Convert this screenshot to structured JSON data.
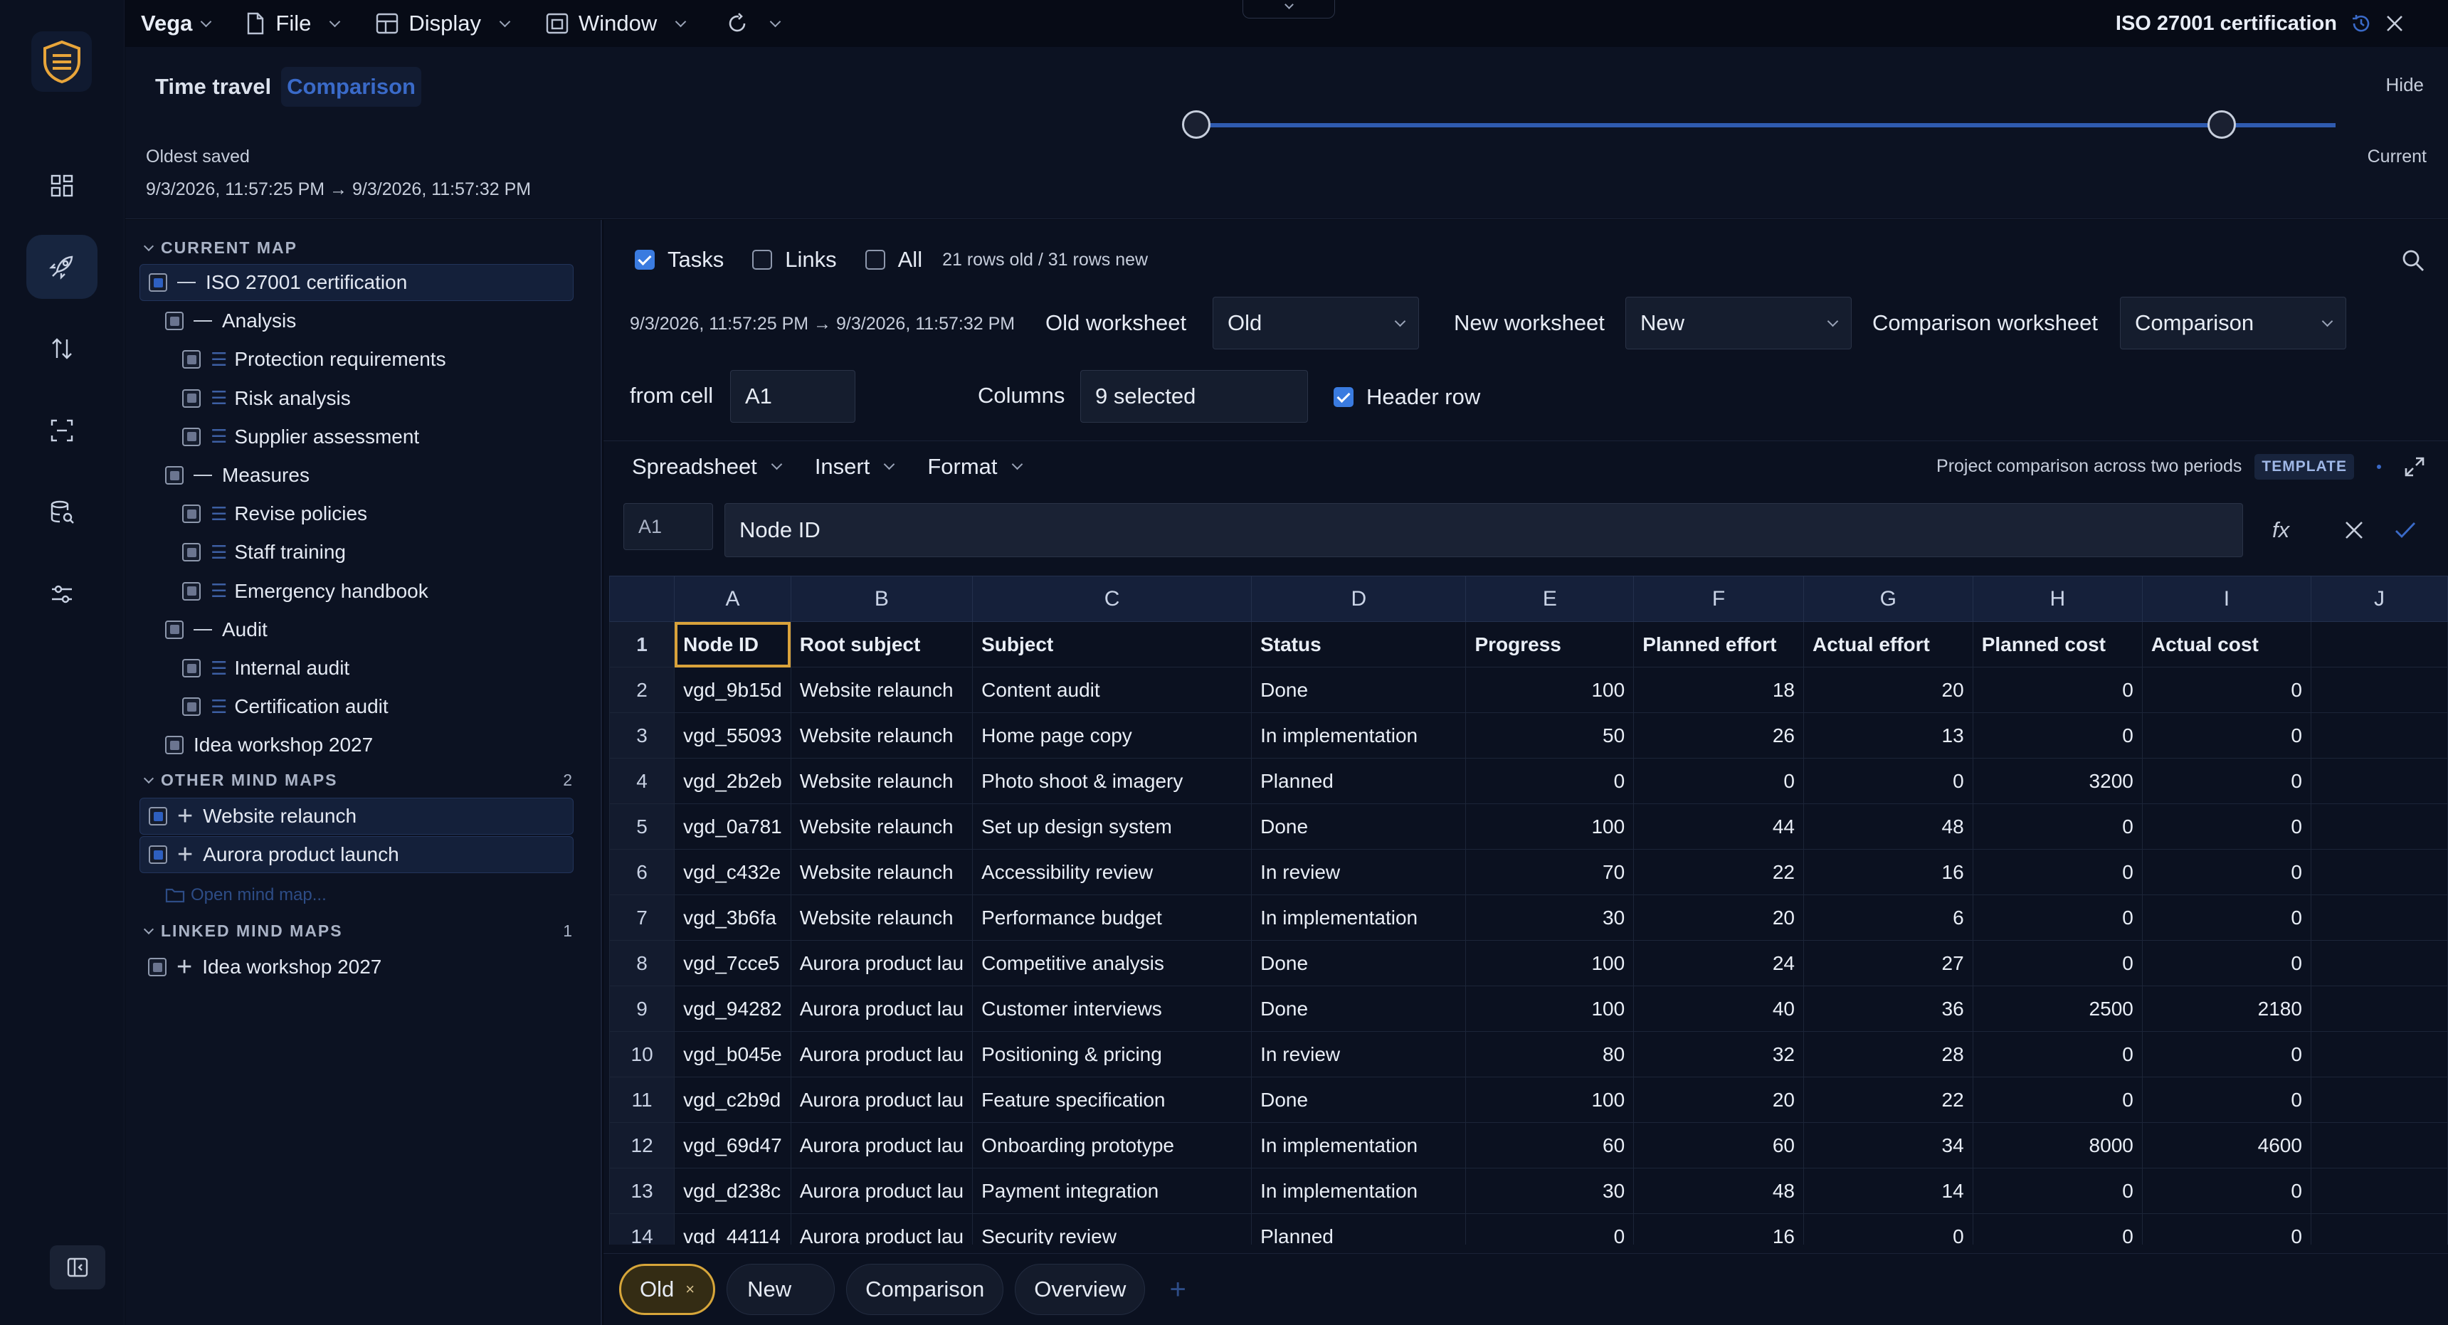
{
  "app": {
    "title": "ISO 27001 certification",
    "hide": "Hide"
  },
  "menu": [
    {
      "label": "Vega"
    },
    {
      "label": "File"
    },
    {
      "label": "Display"
    },
    {
      "label": "Window"
    }
  ],
  "time_travel": {
    "tabs": [
      "Time travel",
      "Comparison"
    ],
    "oldest_label": "Oldest saved",
    "range": "9/3/2026, 11:57:25 PM → 9/3/2026, 11:57:32 PM",
    "current_label": "Current"
  },
  "left": {
    "current_title": "CURRENT MAP",
    "current_items": [
      {
        "label": "ISO 27001 certification",
        "level": 0,
        "kind": "dash"
      },
      {
        "label": "Analysis",
        "level": 1,
        "kind": "dash"
      },
      {
        "label": "Protection requirements",
        "level": 2,
        "kind": "list"
      },
      {
        "label": "Risk analysis",
        "level": 2,
        "kind": "list"
      },
      {
        "label": "Supplier assessment",
        "level": 2,
        "kind": "list"
      },
      {
        "label": "Measures",
        "level": 1,
        "kind": "dash"
      },
      {
        "label": "Revise policies",
        "level": 2,
        "kind": "list"
      },
      {
        "label": "Staff training",
        "level": 2,
        "kind": "list"
      },
      {
        "label": "Emergency handbook",
        "level": 2,
        "kind": "list"
      },
      {
        "label": "Audit",
        "level": 1,
        "kind": "dash"
      },
      {
        "label": "Internal audit",
        "level": 2,
        "kind": "list"
      },
      {
        "label": "Certification audit",
        "level": 2,
        "kind": "list"
      },
      {
        "label": "Idea workshop 2027",
        "level": 1,
        "kind": "none"
      }
    ],
    "other_title": "OTHER MIND MAPS",
    "other_count": "2",
    "other_items": [
      "Website relaunch",
      "Aurora product launch"
    ],
    "open_map": "Open mind map...",
    "linked_title": "LINKED MIND MAPS",
    "linked_count": "1",
    "linked_items": [
      "Idea workshop 2027"
    ]
  },
  "filters": {
    "tasks": "Tasks",
    "links": "Links",
    "all": "All",
    "rows_info": "21 rows old / 31 rows new"
  },
  "config": {
    "range": "9/3/2026, 11:57:25 PM → 9/3/2026, 11:57:32 PM",
    "old_label": "Old worksheet",
    "old_value": "Old",
    "new_label": "New worksheet",
    "new_value": "New",
    "cmp_label": "Comparison worksheet",
    "cmp_value": "Comparison",
    "from_label": "from cell",
    "from_value": "A1",
    "cols_label": "Columns",
    "cols_value": "9 selected",
    "header_row": "Header row"
  },
  "toolbar": {
    "items": [
      "Spreadsheet",
      "Insert",
      "Format"
    ],
    "description": "Project comparison across two periods",
    "badge": "TEMPLATE"
  },
  "formula": {
    "cell_ref": "A1",
    "value": "Node ID",
    "fx": "fx"
  },
  "sheet": {
    "columns": [
      "A",
      "B",
      "C",
      "D",
      "E",
      "F",
      "G",
      "H",
      "I",
      "J"
    ],
    "rows": [
      [
        "Node ID",
        "Root subject",
        "Subject",
        "Status",
        "Progress",
        "Planned effort",
        "Actual effort",
        "Planned cost",
        "Actual cost",
        ""
      ],
      [
        "vgd_9b15d",
        "Website relaunch",
        "Content audit",
        "Done",
        "100",
        "18",
        "20",
        "0",
        "0",
        ""
      ],
      [
        "vgd_55093",
        "Website relaunch",
        "Home page copy",
        "In implementation",
        "50",
        "26",
        "13",
        "0",
        "0",
        ""
      ],
      [
        "vgd_2b2eb",
        "Website relaunch",
        "Photo shoot & imagery",
        "Planned",
        "0",
        "0",
        "0",
        "3200",
        "0",
        ""
      ],
      [
        "vgd_0a781",
        "Website relaunch",
        "Set up design system",
        "Done",
        "100",
        "44",
        "48",
        "0",
        "0",
        ""
      ],
      [
        "vgd_c432e",
        "Website relaunch",
        "Accessibility review",
        "In review",
        "70",
        "22",
        "16",
        "0",
        "0",
        ""
      ],
      [
        "vgd_3b6fa",
        "Website relaunch",
        "Performance budget",
        "In implementation",
        "30",
        "20",
        "6",
        "0",
        "0",
        ""
      ],
      [
        "vgd_7cce5",
        "Aurora product lau",
        "Competitive analysis",
        "Done",
        "100",
        "24",
        "27",
        "0",
        "0",
        ""
      ],
      [
        "vgd_94282",
        "Aurora product lau",
        "Customer interviews",
        "Done",
        "100",
        "40",
        "36",
        "2500",
        "2180",
        ""
      ],
      [
        "vgd_b045e",
        "Aurora product lau",
        "Positioning & pricing",
        "In review",
        "80",
        "32",
        "28",
        "0",
        "0",
        ""
      ],
      [
        "vgd_c2b9d",
        "Aurora product lau",
        "Feature specification",
        "Done",
        "100",
        "20",
        "22",
        "0",
        "0",
        ""
      ],
      [
        "vgd_69d47",
        "Aurora product lau",
        "Onboarding prototype",
        "In implementation",
        "60",
        "60",
        "34",
        "8000",
        "4600",
        ""
      ],
      [
        "vgd_d238c",
        "Aurora product lau",
        "Payment integration",
        "In implementation",
        "30",
        "48",
        "14",
        "0",
        "0",
        ""
      ],
      [
        "vgd_44114",
        "Aurora product lau",
        "Security review",
        "Planned",
        "0",
        "16",
        "0",
        "0",
        "0",
        ""
      ]
    ]
  },
  "tabs": [
    "Old",
    "New",
    "Comparison",
    "Overview"
  ],
  "colors": {
    "accent": "#3a7be0",
    "selected_tab": "#d7a63a",
    "comparison": "#2f5bb0"
  }
}
